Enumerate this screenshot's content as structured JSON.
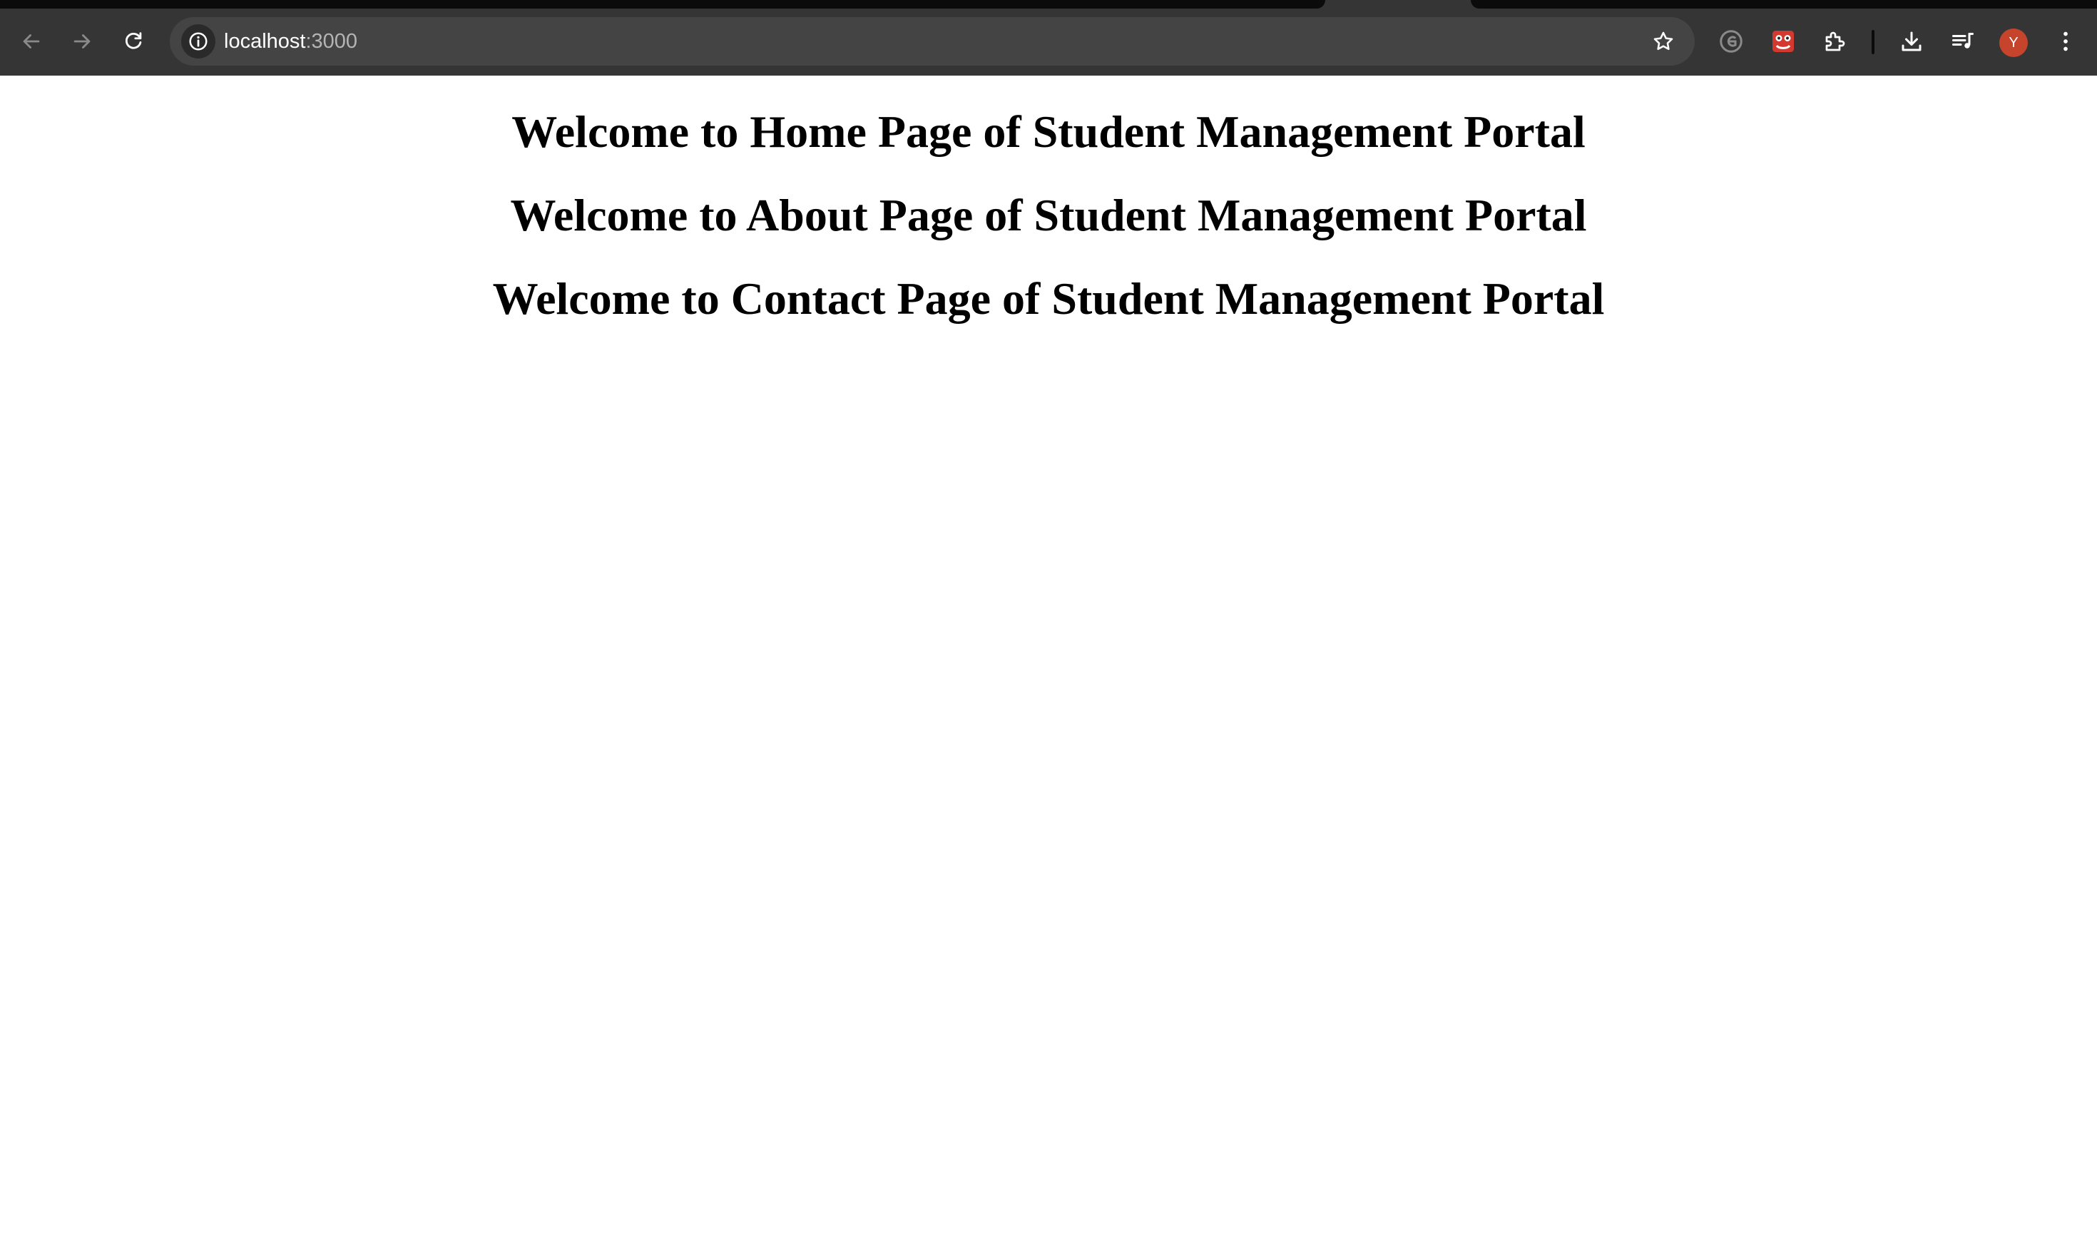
{
  "browser": {
    "address_bar": {
      "host": "localhost",
      "port": ":3000"
    },
    "icons": {
      "back": "back-arrow-icon",
      "forward": "forward-arrow-icon",
      "reload": "reload-icon",
      "site_info": "info-icon",
      "bookmark": "star-icon",
      "extension_1": "grammar-extension-icon",
      "extension_2": "red-extension-icon",
      "extensions": "puzzle-icon",
      "downloads": "download-icon",
      "media": "media-controls-icon",
      "menu": "kebab-menu-icon"
    },
    "profile": {
      "initial": "Y",
      "color": "#c5442b"
    },
    "colors": {
      "toolbar": "#353535",
      "omnibox": "#444444"
    }
  },
  "page": {
    "headings": [
      "Welcome to Home Page of Student Management Portal",
      "Welcome to About Page of Student Management Portal",
      "Welcome to Contact Page of Student Management Portal"
    ]
  }
}
